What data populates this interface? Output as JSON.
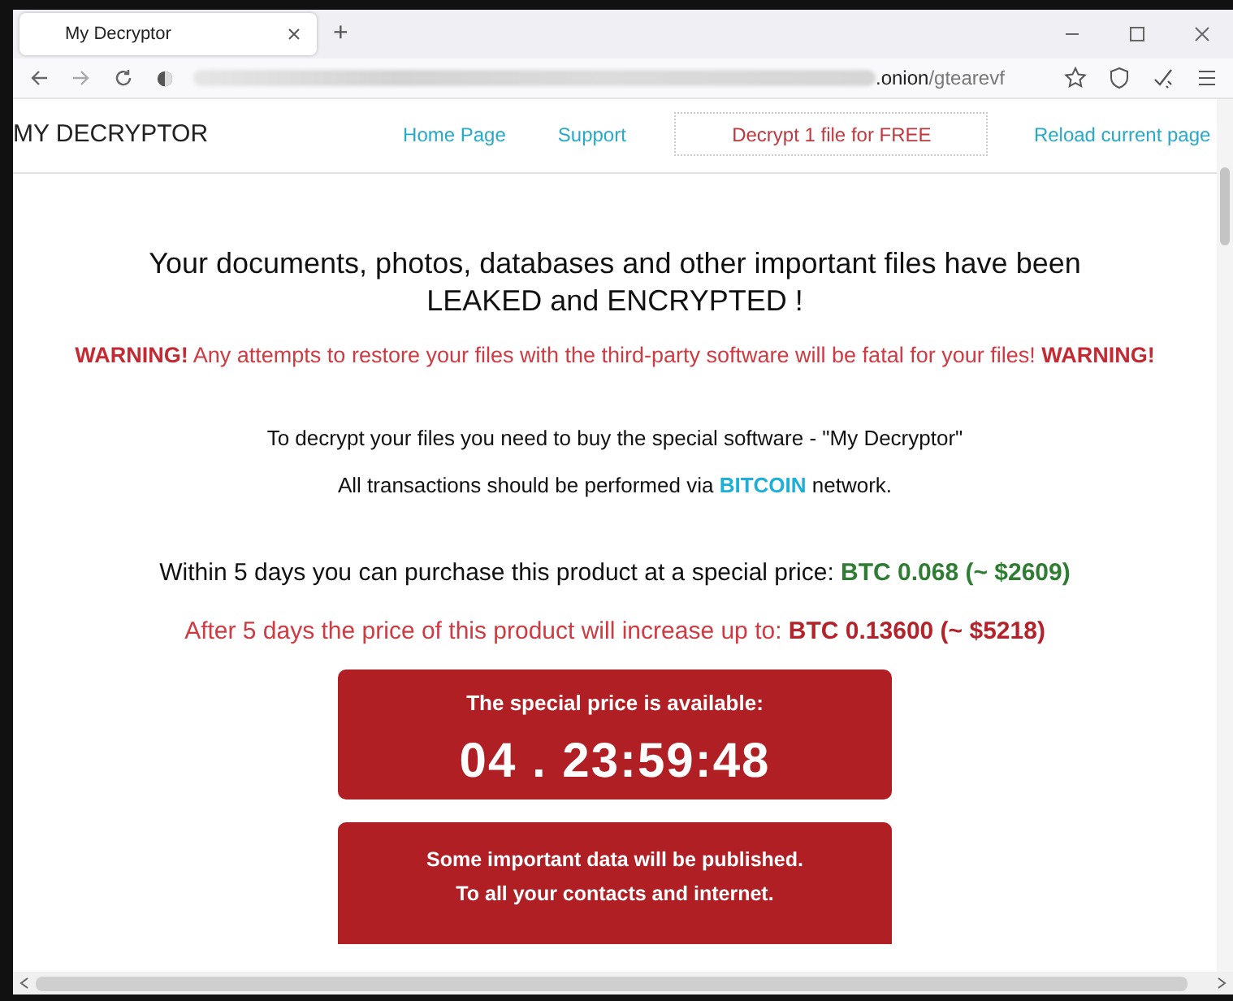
{
  "browser": {
    "tab": {
      "title": "My Decryptor",
      "selected": true
    },
    "new_tab": "+",
    "url": {
      "host_visible": ".onion",
      "path": "/gtearevf"
    }
  },
  "page": {
    "brand": "MY DECRYPTOR",
    "nav": [
      {
        "label": "Home Page",
        "kind": "link"
      },
      {
        "label": "Support",
        "kind": "link"
      },
      {
        "label": "Decrypt 1 file for FREE",
        "kind": "button"
      },
      {
        "label": "Reload current page",
        "kind": "link"
      }
    ],
    "paragraphs": [
      {
        "kind": "headline",
        "text": "Your documents, photos, databases and other important files have been LEAKED and ENCRYPTED !"
      },
      {
        "kind": "warning",
        "text": "**WARNING!** Any attempts to restore your files with the third-party software will be fatal for your files! **WARNING!**"
      },
      {
        "kind": "info",
        "text": "To decrypt your files you need to buy the special software - \"My Decryptor\""
      },
      {
        "kind": "info",
        "text": "All transactions should be performed via **BITCOIN** network."
      },
      {
        "kind": "offer",
        "text": "Within 5 days you can purchase this product at a special price: **BTC 0.068 (~ $2609)**"
      },
      {
        "kind": "increase",
        "text": "After 5 days the price of this product will increase up to: **BTC 0.13600 (~ $5218)**"
      }
    ],
    "timer": {
      "label": "The special price is available:",
      "countdown": "04 . 23:59:48"
    },
    "notice": {
      "lines": [
        "Some important data will be published.",
        "To all your contacts and internet."
      ]
    }
  }
}
